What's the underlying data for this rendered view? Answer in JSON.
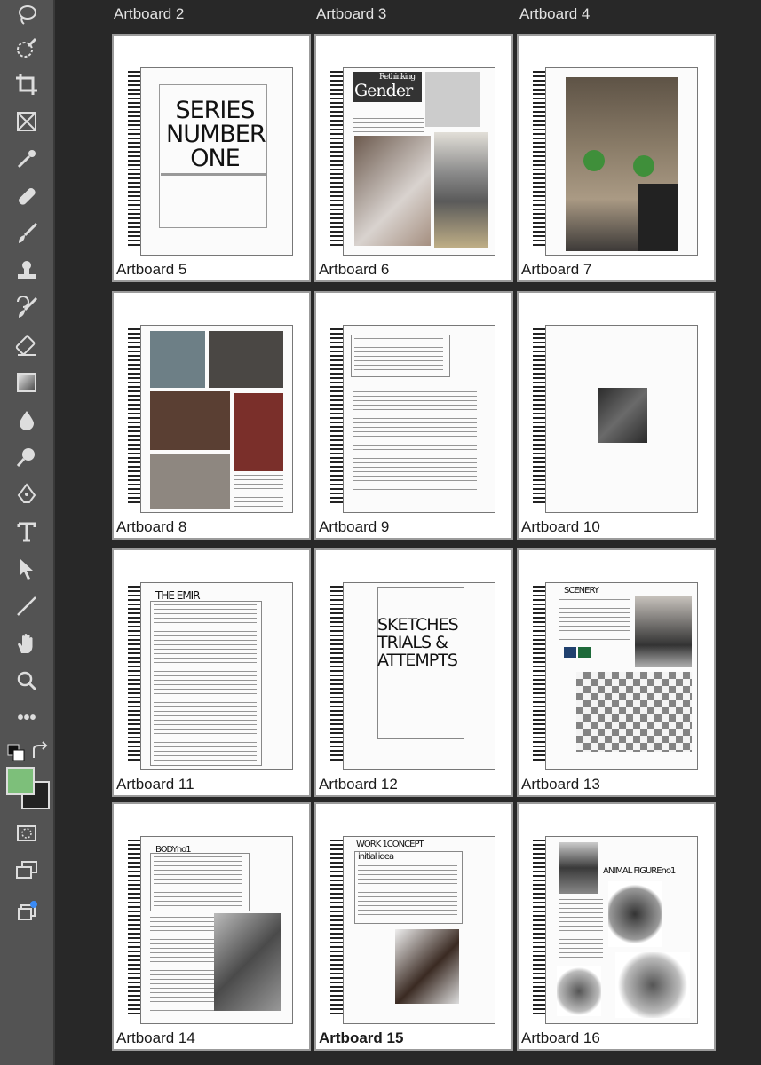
{
  "toolbar": {
    "tools": [
      "lasso-icon",
      "quick-selection-icon",
      "crop-icon",
      "frame-icon",
      "eyedropper-icon",
      "healing-brush-icon",
      "brush-icon",
      "clone-stamp-icon",
      "history-brush-icon",
      "eraser-icon",
      "gradient-icon",
      "blur-icon",
      "dodge-icon",
      "pen-icon",
      "type-icon",
      "path-selection-icon",
      "line-icon",
      "hand-icon",
      "zoom-icon",
      "more-tools-icon"
    ],
    "foreground_color": "#7dbf7a",
    "background_color": "#222222",
    "ellipsis": "•••"
  },
  "top_labels": [
    "Artboard 2",
    "Artboard 3",
    "Artboard 4"
  ],
  "artboards": [
    {
      "label": "Artboard 5"
    },
    {
      "label": "Artboard 6"
    },
    {
      "label": "Artboard 7"
    },
    {
      "label": "Artboard 8"
    },
    {
      "label": "Artboard 9"
    },
    {
      "label": "Artboard 10"
    },
    {
      "label": "Artboard 11"
    },
    {
      "label": "Artboard 12"
    },
    {
      "label": "Artboard 13"
    },
    {
      "label": "Artboard 14"
    },
    {
      "label": "Artboard 15"
    },
    {
      "label": "Artboard 16"
    }
  ],
  "page_text": {
    "series": "SERIES NUMBER ONE",
    "rethinking": "Rethinking",
    "gender": "Gender",
    "emir": "THE EMIR",
    "sketches": "SKETCHES TRIALS & ATTEMPTS",
    "scenery": "SCENERY",
    "body": "BODYno1",
    "work": "WORK 1CONCEPT",
    "initial": "initial idea",
    "animal": "ANIMAL FIGUREno1"
  }
}
